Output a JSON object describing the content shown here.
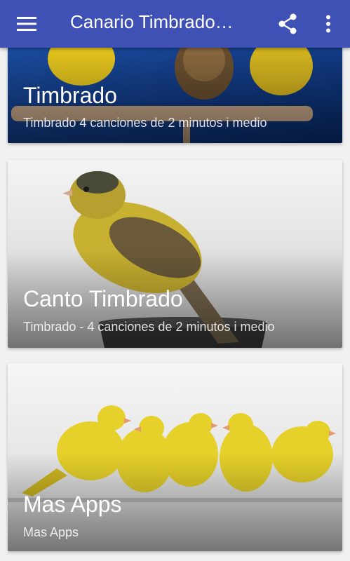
{
  "appbar": {
    "title": "Canario Timbrado…",
    "color": "#3f51b5",
    "icons": [
      "menu-icon",
      "share-icon",
      "more-vert-icon"
    ]
  },
  "cards": [
    {
      "heading": "Timbrado",
      "subtitle": "Timbrado 4 canciones de 2 minutos i medio"
    },
    {
      "heading": "Canto Timbrado",
      "subtitle": "Timbrado - 4 canciones de 2 minutos i medio"
    },
    {
      "heading": "Mas Apps",
      "subtitle": "Mas Apps"
    }
  ]
}
